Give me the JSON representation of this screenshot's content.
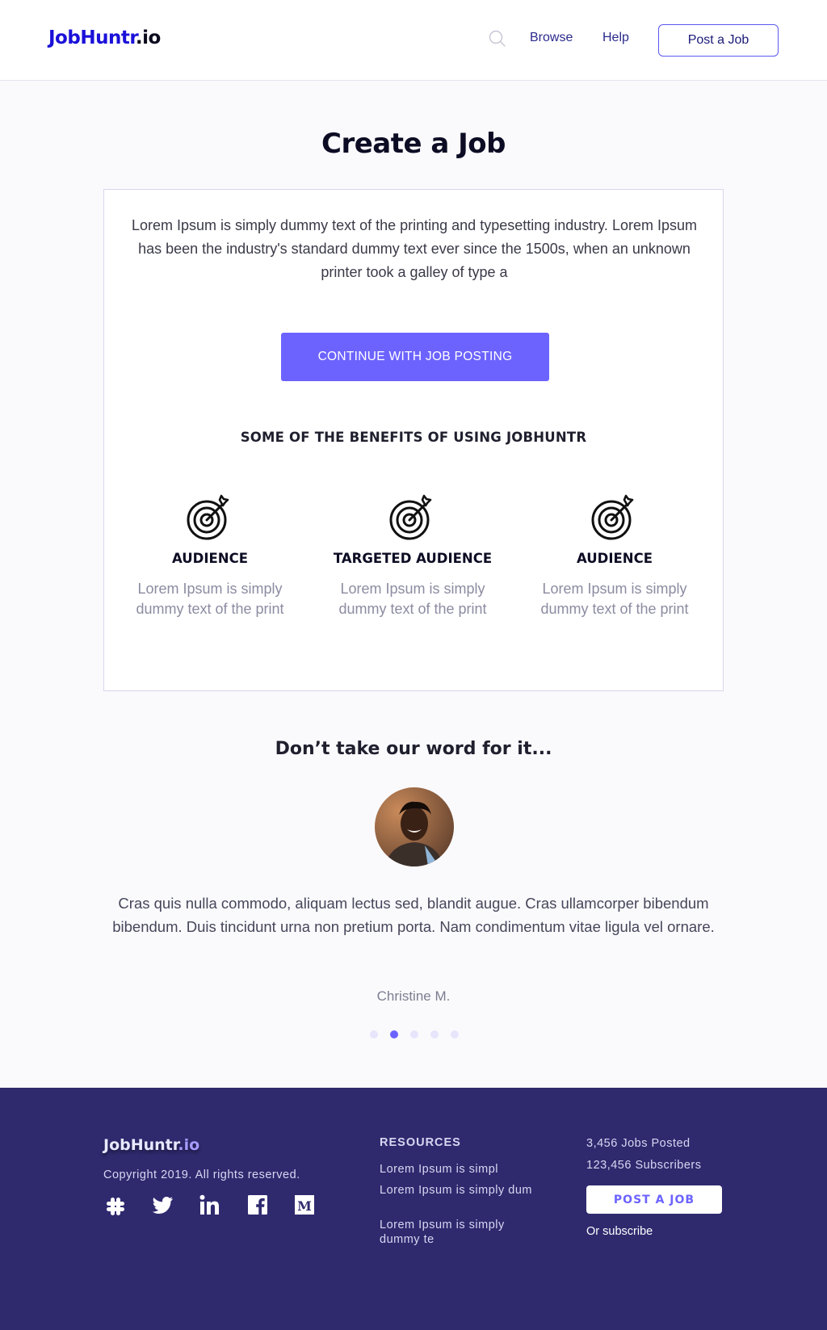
{
  "header": {
    "logo_brand": "JobHuntr",
    "logo_tld": ".io",
    "nav": {
      "browse": "Browse",
      "help": "Help"
    },
    "post_job": "Post a Job"
  },
  "main": {
    "title": "Create a Job",
    "intro": "Lorem Ipsum is simply dummy text of the printing and typesetting industry. Lorem Ipsum has been the industry's standard dummy text ever since the 1500s, when an unknown printer took a galley of type a",
    "continue_label": "CONTINUE WITH JOB POSTING",
    "benefits_title": "SOME OF THE BENEFITS OF USING JOBHUNTR",
    "benefits": [
      {
        "icon": "target-icon",
        "title": "AUDIENCE",
        "desc": "Lorem Ipsum is simply dummy text of the print"
      },
      {
        "icon": "target-icon",
        "title": "TARGETED AUDIENCE",
        "desc": "Lorem Ipsum is simply dummy text of the print"
      },
      {
        "icon": "target-icon",
        "title": "AUDIENCE",
        "desc": "Lorem Ipsum is simply dummy text of the print"
      }
    ]
  },
  "testimonial": {
    "heading": "Don’t take our word for it...",
    "quote": "Cras quis nulla commodo, aliquam lectus sed, blandit augue. Cras ullamcorper bibendum bibendum. Duis tincidunt urna non pretium porta. Nam condimentum vitae ligula vel ornare.",
    "author": "Christine M.",
    "slides": 5,
    "active_slide": 2
  },
  "footer": {
    "logo_brand": "JobHuntr",
    "logo_tld": ".io",
    "copyright": "Copyright 2019. All rights reserved.",
    "socials": [
      "slack-icon",
      "twitter-icon",
      "linkedin-icon",
      "facebook-icon",
      "medium-icon"
    ],
    "resources_title": "RESOURCES",
    "resources": [
      "Lorem Ipsum is simpl",
      "Lorem Ipsum is simply dum",
      "Lorem Ipsum is simply dummy te"
    ],
    "jobs_posted": "3,456 Jobs Posted",
    "subscribers": "123,456 Subscribers",
    "post_job": "POST A JOB",
    "subscribe": "Or subscribe"
  },
  "colors": {
    "accent": "#6c63ff",
    "brand": "#1b11d9",
    "footer_bg": "#2f2a6e"
  }
}
